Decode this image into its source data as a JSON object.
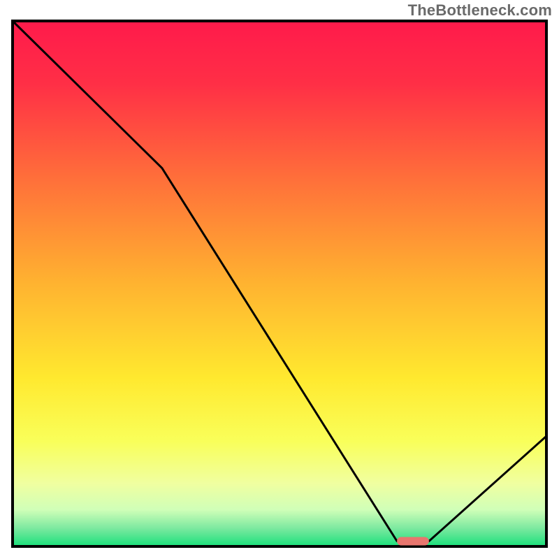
{
  "watermark": "TheBottleneck.com",
  "chart_data": {
    "type": "line",
    "title": "",
    "xlabel": "",
    "ylabel": "",
    "xlim": [
      0,
      100
    ],
    "ylim": [
      0,
      100
    ],
    "grid": false,
    "legend": false,
    "series": [
      {
        "name": "bottleneck-curve",
        "x": [
          0,
          28,
          72,
          78,
          100
        ],
        "y": [
          100,
          72,
          1,
          1,
          21
        ]
      }
    ],
    "marker": {
      "name": "target-range",
      "x_start": 72,
      "x_end": 78,
      "y": 1,
      "color": "#e8766e"
    },
    "background_gradient": {
      "stops": [
        {
          "pos": 0.0,
          "color": "#ff1a4b"
        },
        {
          "pos": 0.12,
          "color": "#ff2f46"
        },
        {
          "pos": 0.3,
          "color": "#ff6f3a"
        },
        {
          "pos": 0.5,
          "color": "#ffb330"
        },
        {
          "pos": 0.68,
          "color": "#ffe92f"
        },
        {
          "pos": 0.8,
          "color": "#f9ff5a"
        },
        {
          "pos": 0.88,
          "color": "#f0ffa0"
        },
        {
          "pos": 0.93,
          "color": "#d0ffb8"
        },
        {
          "pos": 0.965,
          "color": "#7de9a0"
        },
        {
          "pos": 1.0,
          "color": "#19e07b"
        }
      ]
    },
    "plot_border_color": "#000000",
    "line_color": "#000000",
    "line_width": 3
  }
}
